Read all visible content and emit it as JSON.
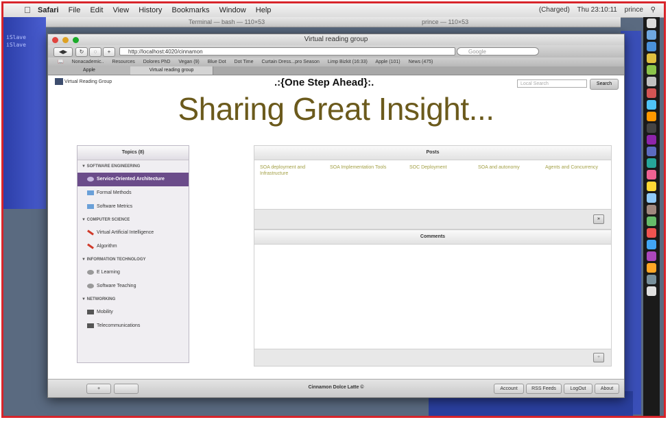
{
  "menubar": {
    "app": "Safari",
    "items": [
      "File",
      "Edit",
      "View",
      "History",
      "Bookmarks",
      "Window",
      "Help"
    ],
    "status": [
      "(Charged)",
      "Thu 23:10:11",
      "prince"
    ]
  },
  "terminal": {
    "title_left": "Terminal — bash — 110×53",
    "title_right": "prince — 110×53",
    "lines": [
      "iSlave",
      "iSlave",
      "",
      "",
      "",
      "",
      ""
    ]
  },
  "browser": {
    "title": "Virtual reading group",
    "url": "http://localhost:4020/cinnamon",
    "search_placeholder": "Google",
    "bookmarks": [
      "Nonacademic..",
      "Resources",
      "Dolores PhD",
      "Vegan (9)",
      "Blue Dot",
      "Dot Time",
      "Curtain Dress...pro Season",
      "Limp Bizkit (16:33)",
      "Apple (101)",
      "News (475)"
    ],
    "tabs": [
      "Apple",
      "Virtual reading group"
    ]
  },
  "page": {
    "logo_text": "Virtual Reading Group",
    "slogan": ".:{One Step Ahead}:.",
    "search_placeholder": "Local Search",
    "search_button": "Search",
    "headline": "Sharing Great Insight..."
  },
  "topics": {
    "title": "Topics (8)",
    "categories": [
      {
        "name": "SOFTWARE ENGINEERING",
        "items": [
          "Service-Oriented Architecture",
          "Formal Methods",
          "Software Metrics"
        ]
      },
      {
        "name": "COMPUTER SCIENCE",
        "items": [
          "Virtual Artificial Intelligence",
          "Algorithm"
        ]
      },
      {
        "name": "INFORMATION TECHNOLOGY",
        "items": [
          "E Learning",
          "Software Teaching"
        ]
      },
      {
        "name": "NETWORKING",
        "items": [
          "Mobility",
          "Telecommunications"
        ]
      }
    ]
  },
  "posts": {
    "title": "Posts",
    "links": [
      "SOA deployment and Infrastructure",
      "SOA Implementation Tools",
      "SOC Deployment",
      "SOA and autonomy",
      "Agents and Concurrency"
    ],
    "more_button": "»"
  },
  "comments": {
    "title": "Comments",
    "add_button": "+"
  },
  "footer": {
    "copyright": "Cinnamon Dolce Latte ©",
    "left_buttons": [
      "+",
      ""
    ],
    "buttons": [
      "Account",
      "RSS Feeds",
      "LogOut",
      "About"
    ]
  },
  "colors": {
    "headline": "#6b5a1c",
    "selected_topic": "#6b4c8a",
    "post_link": "#a3a046",
    "frame_border": "#d8252b"
  }
}
